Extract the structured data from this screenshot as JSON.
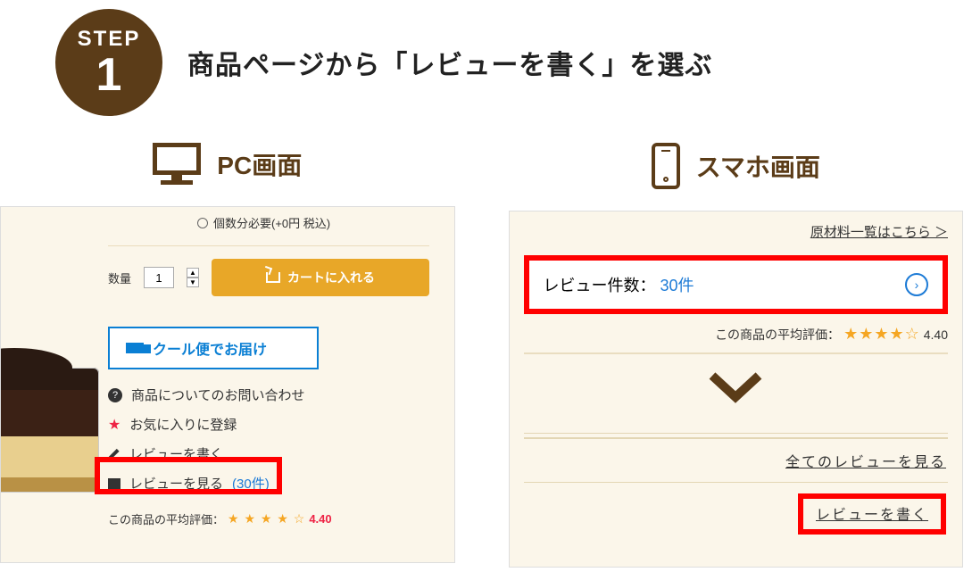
{
  "step": {
    "label": "STEP",
    "number": "1",
    "title": "商品ページから「レビューを書く」を選ぶ"
  },
  "columns": {
    "pc": "PC画面",
    "sp": "スマホ画面"
  },
  "pc": {
    "option_label": "個数分必要(+0円 税込)",
    "qty_label": "数量",
    "qty_value": "1",
    "add_cart": "カートに入れる",
    "cool": "クール便でお届け",
    "inquiry": "商品についてのお問い合わせ",
    "favorite": "お気に入りに登録",
    "write_review": "レビューを書く",
    "view_review_prefix": "レビューを見る",
    "view_review_count": "(30件)",
    "avg_label": "この商品の平均評価：",
    "avg_value": "4.40",
    "stars": "★ ★ ★ ★ ☆"
  },
  "sp": {
    "ingredients_link": "原材料一覧はこちら ＞",
    "review_count_label": "レビュー件数：",
    "review_count_value": "30件",
    "avg_label": "この商品の平均評価：",
    "avg_value": "4.40",
    "stars": "★★★★☆",
    "view_all": "全てのレビューを見る",
    "write_review": "レビューを書く"
  }
}
